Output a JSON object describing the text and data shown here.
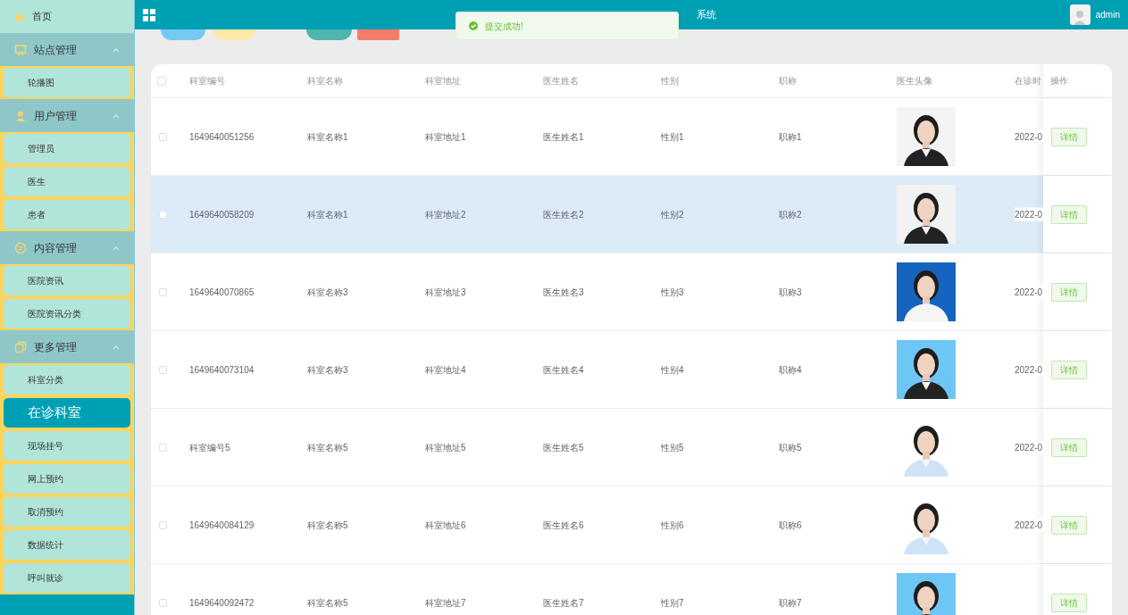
{
  "sidebar": {
    "home": {
      "label": "首页"
    },
    "groups": [
      {
        "label": "站点管理",
        "expanded": true,
        "items": [
          {
            "label": "轮播图",
            "selected": false
          }
        ]
      },
      {
        "label": "用户管理",
        "expanded": true,
        "items": [
          {
            "label": "管理员",
            "selected": false
          },
          {
            "label": "医生",
            "selected": false
          },
          {
            "label": "患者",
            "selected": false
          }
        ]
      },
      {
        "label": "内容管理",
        "expanded": true,
        "items": [
          {
            "label": "医院资讯",
            "selected": false
          },
          {
            "label": "医院资讯分类",
            "selected": false
          }
        ]
      },
      {
        "label": "更多管理",
        "expanded": true,
        "items": [
          {
            "label": "科室分类",
            "selected": false
          },
          {
            "label": "在诊科室",
            "selected": true
          },
          {
            "label": "现场挂号",
            "selected": false
          },
          {
            "label": "网上预约",
            "selected": false
          },
          {
            "label": "取消预约",
            "selected": false
          },
          {
            "label": "数据统计",
            "selected": false
          },
          {
            "label": "呼叫就诊",
            "selected": false
          }
        ]
      }
    ]
  },
  "header": {
    "title": "系统",
    "user": "admin"
  },
  "toast": {
    "kind": "success",
    "message": "提交成功!"
  },
  "toolbar": [
    {
      "color": "#74c9f5"
    },
    {
      "color": "#ffe9a8"
    },
    {
      "color": "#4fb5ad"
    },
    {
      "color": "#f57b6a"
    }
  ],
  "table": {
    "all_checked": false,
    "columns": [
      "科室编号",
      "科室名称",
      "科室地址",
      "医生姓名",
      "性别",
      "职称",
      "医生头像",
      "在诊时",
      "操作"
    ],
    "rows": [
      {
        "selected": false,
        "checked": false,
        "cells": [
          "1649640051256",
          "科室名称1",
          "科室地址1",
          "医生姓名1",
          "性别1",
          "职称1"
        ],
        "photo": {
          "kind": "picture"
        },
        "date": "2022-0",
        "action": "详情"
      },
      {
        "selected": true,
        "checked": false,
        "cells": [
          "1649640058209",
          "科室名称1",
          "科室地址2",
          "医生姓名2",
          "性别2",
          "职称2"
        ],
        "photo": {
          "kind": "picture"
        },
        "date": "2022-0",
        "action": "详情"
      },
      {
        "selected": false,
        "checked": false,
        "cells": [
          "1649640070865",
          "科室名称3",
          "科室地址3",
          "医生姓名3",
          "性别3",
          "职称3"
        ],
        "photo": {
          "kind": "picture"
        },
        "date": "2022-0",
        "action": "详情"
      },
      {
        "selected": false,
        "checked": false,
        "cells": [
          "1649640073104",
          "科室名称3",
          "科室地址4",
          "医生姓名4",
          "性别4",
          "职称4"
        ],
        "photo": {
          "kind": "picture"
        },
        "date": "2022-0",
        "action": "详情"
      },
      {
        "selected": false,
        "checked": false,
        "cells": [
          "科室编号5",
          "科室名称5",
          "科室地址5",
          "医生姓名5",
          "性别5",
          "职称5"
        ],
        "photo": {
          "kind": "picture"
        },
        "date": "2022-0",
        "action": "详情"
      },
      {
        "selected": false,
        "checked": false,
        "cells": [
          "1649640084129",
          "科室名称5",
          "科室地址6",
          "医生姓名6",
          "性别6",
          "职称6"
        ],
        "photo": {
          "kind": "picture"
        },
        "date": "2022-0",
        "action": "详情"
      },
      {
        "selected": false,
        "checked": false,
        "cells": [
          "1649640092472",
          "科室名称5",
          "科室地址7",
          "医生姓名7",
          "性别7",
          "职称7"
        ],
        "photo": {
          "kind": "picture"
        },
        "action": "详情"
      }
    ]
  }
}
